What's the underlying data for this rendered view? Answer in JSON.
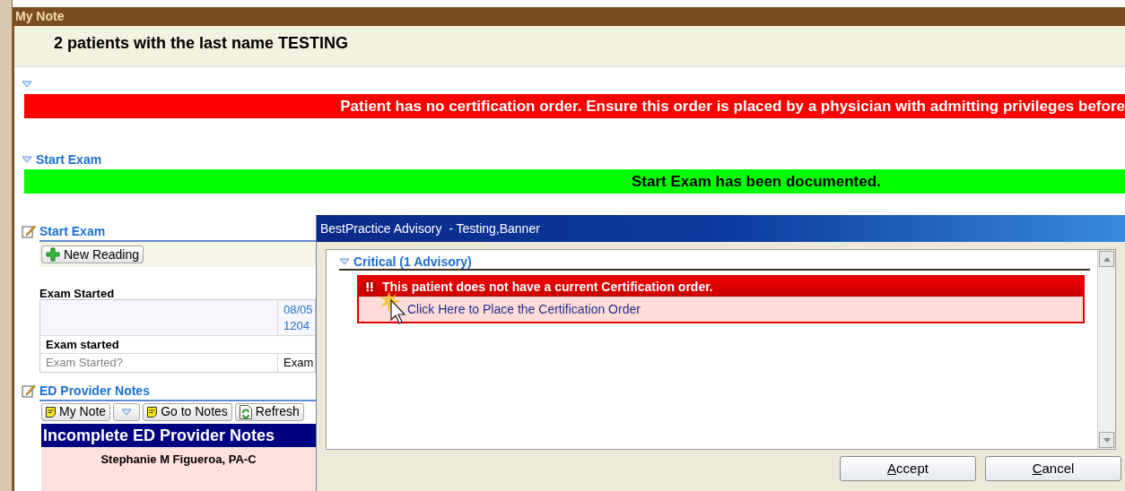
{
  "window": {
    "title": "My Note"
  },
  "header": {
    "text": "2 patients with the last name TESTING"
  },
  "alerts": [
    {
      "message": "Patient has no certification order. Ensure this order is placed by a physician with admitting privileges before",
      "kind": "error"
    },
    {
      "heading": "Start Exam",
      "message": "Start Exam has been documented.",
      "kind": "success"
    }
  ],
  "start_exam": {
    "title": "Start Exam",
    "toolbar": [
      "New Reading"
    ],
    "group_label": "Exam Started",
    "date_lines": [
      "08/05",
      "1204"
    ],
    "row_label": "Exam started",
    "question": "Exam Started?",
    "answer": "Exam"
  },
  "provider_notes": {
    "title": "ED Provider Notes",
    "toolbar": [
      {
        "label": "My Note",
        "kind": "note"
      },
      {
        "kind": "dropdown"
      },
      {
        "label": "Go to Notes",
        "kind": "note"
      },
      {
        "label": "Refresh",
        "kind": "refresh"
      }
    ],
    "banner": "Incomplete ED Provider Notes",
    "author": "Stephanie M Figueroa, PA-C"
  },
  "dialog": {
    "title": "BestPractice Advisory  - Testing,Banner",
    "section": "Critical (1 Advisory)",
    "advisory": "This patient does not have a current Certification order.",
    "link": "Click Here to Place the Certification Order",
    "buttons": [
      "Accept",
      "Cancel"
    ]
  }
}
